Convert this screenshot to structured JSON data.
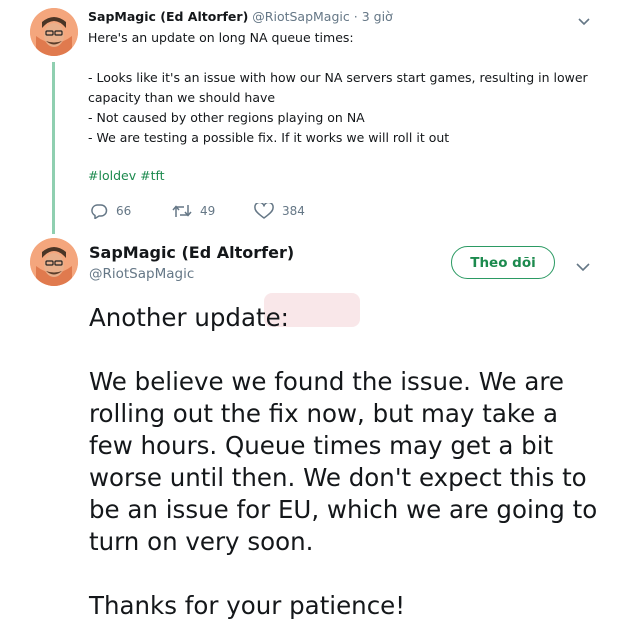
{
  "tweet1": {
    "author_name": "SapMagic (Ed Altorfer)",
    "author_handle": "@RiotSapMagic",
    "separator": "·",
    "time": "3 giờ",
    "lines": [
      "Here's an update on long NA queue times:",
      "",
      "- Looks like it's an issue with how our NA servers start games, resulting in lower",
      "capacity than we should have",
      "- Not caused by other regions playing on NA",
      "- We are testing a possible fix. If it works we will roll it out"
    ],
    "hashtags": [
      "#loldev",
      "#tft"
    ],
    "reply_count": "66",
    "retweet_count": "49",
    "like_count": "384"
  },
  "tweet2": {
    "author_name": "SapMagic (Ed Altorfer)",
    "author_handle": "@RiotSapMagic",
    "follow_label": "Theo dõi",
    "lines": [
      "Another update:",
      "",
      "We believe we found the issue. We are",
      "rolling out the fix now, but may take a",
      "few hours. Queue times may get a bit",
      "worse until then. We don't expect this to",
      "be an issue for EU, which we are going to",
      "turn on very soon.",
      "",
      "Thanks for your patience!"
    ]
  },
  "colors": {
    "accent": "#1c8a4e",
    "thread_line": "#8fcfb0",
    "muted": "#657786",
    "text": "#14171a"
  },
  "icons": {
    "reply": "reply-icon",
    "retweet": "retweet-icon",
    "like": "heart-icon",
    "caret": "chevron-down-icon"
  }
}
